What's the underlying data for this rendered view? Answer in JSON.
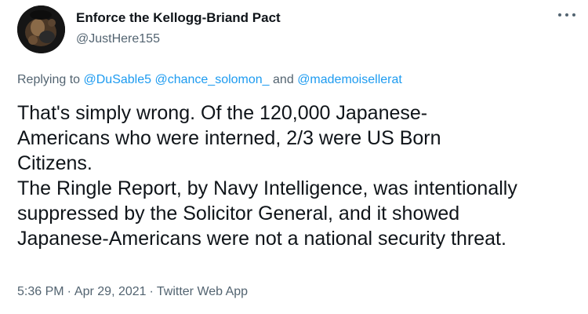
{
  "author": {
    "display_name": "Enforce the Kellogg-Briand Pact",
    "handle": "@JustHere155",
    "avatar_icon": "profile-avatar"
  },
  "more_icon": "more-options-icon",
  "reply_context": {
    "prefix": "Replying to",
    "mentions": [
      "@DuSable5",
      "@chance_solomon_",
      "@mademoisellerat"
    ],
    "conjunction": "and"
  },
  "tweet": {
    "lines": [
      "That's simply wrong. Of the 120,000 Japanese-",
      "Americans who were interned, 2/3 were US Born",
      "Citizens.",
      "The Ringle Report, by Navy Intelligence, was intentionally",
      "suppressed by the Solicitor General, and it showed",
      "Japanese-Americans were not a national security threat."
    ]
  },
  "meta": {
    "time": "5:36 PM",
    "separator": "·",
    "date": "Apr 29, 2021",
    "source": "Twitter Web App"
  },
  "colors": {
    "text": "#0f1419",
    "secondary": "#536471",
    "link": "#1d9bf0"
  }
}
